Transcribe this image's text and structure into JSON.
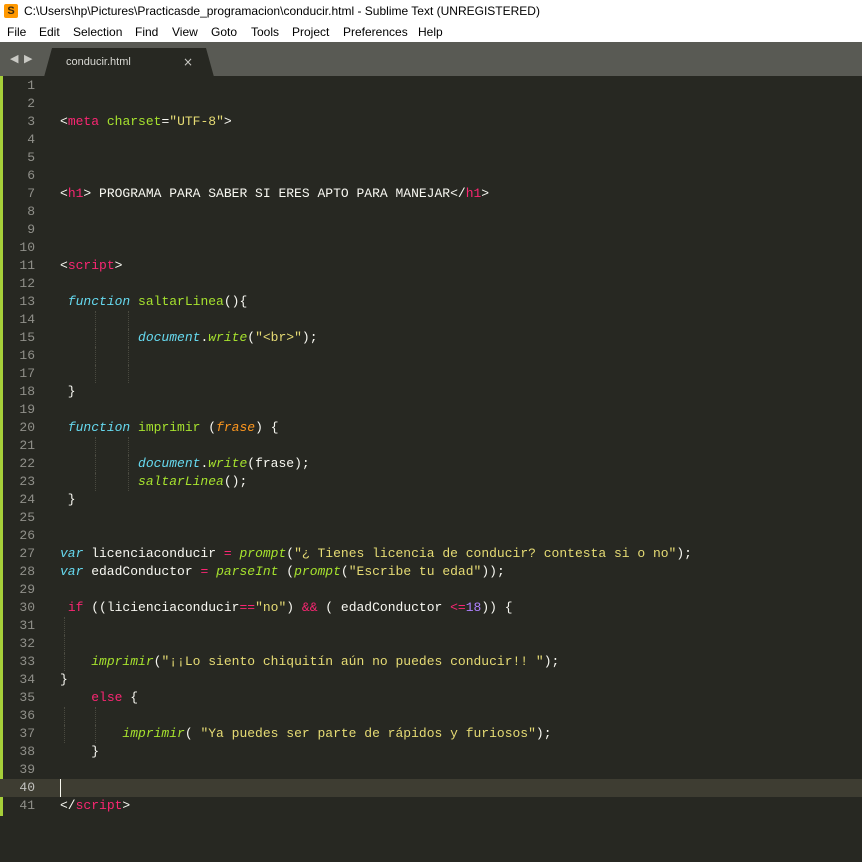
{
  "window": {
    "title": "C:\\Users\\hp\\Pictures\\Practicasde_programacion\\conducir.html - Sublime Text (UNREGISTERED)",
    "icon": "S"
  },
  "menu": {
    "items": [
      "File",
      "Edit",
      "Selection",
      "Find",
      "View",
      "Goto",
      "Tools",
      "Project",
      "Preferences",
      "Help"
    ]
  },
  "tabs": {
    "back": "◀",
    "forward": "▶",
    "active": {
      "label": "conducir.html",
      "close": "×"
    }
  },
  "colors": {
    "background": "#272822",
    "text": "#f8f8f2",
    "keyword": "#f92672",
    "tag": "#f92672",
    "storage": "#66d9ef",
    "function": "#a6e22e",
    "string": "#e6db74",
    "number": "#ae81ff",
    "parameter": "#fd971f",
    "gutter_marker": "#a6cf39"
  },
  "editor": {
    "current_line": 40,
    "lines": [
      {
        "n": "1",
        "t": []
      },
      {
        "n": "2",
        "t": []
      },
      {
        "n": "3",
        "t": [
          [
            "p",
            "<"
          ],
          [
            "t",
            "meta"
          ],
          [
            "p",
            " "
          ],
          [
            "a",
            "charset"
          ],
          [
            "p",
            "="
          ],
          [
            "s",
            "\"UTF-8\""
          ],
          [
            "p",
            ">"
          ]
        ]
      },
      {
        "n": "4",
        "t": []
      },
      {
        "n": "5",
        "t": []
      },
      {
        "n": "6",
        "t": []
      },
      {
        "n": "7",
        "t": [
          [
            "p",
            "<"
          ],
          [
            "t",
            "h1"
          ],
          [
            "p",
            "> PROGRAMA PARA SABER SI ERES APTO PARA MANEJAR</"
          ],
          [
            "t",
            "h1"
          ],
          [
            "p",
            ">"
          ]
        ]
      },
      {
        "n": "8",
        "t": []
      },
      {
        "n": "9",
        "t": []
      },
      {
        "n": "10",
        "t": []
      },
      {
        "n": "11",
        "t": [
          [
            "p",
            "<"
          ],
          [
            "t",
            "script"
          ],
          [
            "p",
            ">"
          ]
        ]
      },
      {
        "n": "12",
        "t": []
      },
      {
        "n": "13",
        "t": [
          [
            "p",
            " "
          ],
          [
            "c",
            "function"
          ],
          [
            "p",
            " "
          ],
          [
            "f",
            "saltarLinea"
          ],
          [
            "p",
            "(){"
          ]
        ]
      },
      {
        "n": "14",
        "t": []
      },
      {
        "n": "15",
        "t": [
          [
            "p",
            "          "
          ],
          [
            "c",
            "document"
          ],
          [
            "p",
            "."
          ],
          [
            "c",
            "write"
          ],
          [
            "p",
            "("
          ],
          [
            "s",
            "\"<br>\""
          ],
          [
            "p",
            ");"
          ]
        ]
      },
      {
        "n": "16",
        "t": []
      },
      {
        "n": "17",
        "t": []
      },
      {
        "n": "18",
        "t": [
          [
            "p",
            " }"
          ]
        ]
      },
      {
        "n": "19",
        "t": []
      },
      {
        "n": "20",
        "t": [
          [
            "p",
            " "
          ],
          [
            "c",
            "function"
          ],
          [
            "p",
            " "
          ],
          [
            "f",
            "imprimir"
          ],
          [
            "p",
            " ("
          ],
          [
            "v",
            "frase"
          ],
          [
            "p",
            ") {"
          ]
        ]
      },
      {
        "n": "21",
        "t": []
      },
      {
        "n": "22",
        "t": [
          [
            "p",
            "          "
          ],
          [
            "c",
            "document"
          ],
          [
            "p",
            "."
          ],
          [
            "c",
            "write"
          ],
          [
            "p",
            "(frase);"
          ]
        ]
      },
      {
        "n": "23",
        "t": [
          [
            "p",
            "          "
          ],
          [
            "c",
            "saltarLinea"
          ],
          [
            "p",
            "();"
          ]
        ]
      },
      {
        "n": "24",
        "t": [
          [
            "p",
            " }"
          ]
        ]
      },
      {
        "n": "25",
        "t": []
      },
      {
        "n": "26",
        "t": []
      },
      {
        "n": "27",
        "t": [
          [
            "c",
            "var"
          ],
          [
            "p",
            " licenciaconducir "
          ],
          [
            "k",
            "="
          ],
          [
            "p",
            " "
          ],
          [
            "c",
            "prompt"
          ],
          [
            "p",
            "("
          ],
          [
            "s",
            "\"¿ Tienes licencia de conducir? contesta si o no\""
          ],
          [
            "p",
            ");"
          ]
        ]
      },
      {
        "n": "28",
        "t": [
          [
            "c",
            "var"
          ],
          [
            "p",
            " edadConductor "
          ],
          [
            "k",
            "="
          ],
          [
            "p",
            " "
          ],
          [
            "c",
            "parseInt"
          ],
          [
            "p",
            " ("
          ],
          [
            "c",
            "prompt"
          ],
          [
            "p",
            "("
          ],
          [
            "s",
            "\"Escribe tu edad\""
          ],
          [
            "p",
            "));"
          ]
        ]
      },
      {
        "n": "29",
        "t": []
      },
      {
        "n": "30",
        "t": [
          [
            "p",
            " "
          ],
          [
            "k",
            "if"
          ],
          [
            "p",
            " ((licienciaconducir"
          ],
          [
            "k",
            "=="
          ],
          [
            "s",
            "\"no\""
          ],
          [
            "p",
            ") "
          ],
          [
            "k",
            "&&"
          ],
          [
            "p",
            " ( edadConductor "
          ],
          [
            "k",
            "<="
          ],
          [
            "n",
            "18"
          ],
          [
            "p",
            ")) {"
          ]
        ]
      },
      {
        "n": "31",
        "t": []
      },
      {
        "n": "32",
        "t": []
      },
      {
        "n": "33",
        "t": [
          [
            "p",
            "    "
          ],
          [
            "c",
            "imprimir"
          ],
          [
            "p",
            "("
          ],
          [
            "s",
            "\"¡¡Lo siento chiquitín aún no puedes conducir!! \""
          ],
          [
            "p",
            ");"
          ]
        ]
      },
      {
        "n": "34",
        "t": [
          [
            "p",
            "}"
          ]
        ]
      },
      {
        "n": "35",
        "t": [
          [
            "p",
            "    "
          ],
          [
            "k",
            "else"
          ],
          [
            "p",
            " {"
          ]
        ]
      },
      {
        "n": "36",
        "t": []
      },
      {
        "n": "37",
        "t": [
          [
            "p",
            "        "
          ],
          [
            "c",
            "imprimir"
          ],
          [
            "p",
            "( "
          ],
          [
            "s",
            "\"Ya puedes ser parte de rápidos y furiosos\""
          ],
          [
            "p",
            ");"
          ]
        ]
      },
      {
        "n": "38",
        "t": [
          [
            "p",
            "    }"
          ]
        ]
      },
      {
        "n": "39",
        "t": []
      },
      {
        "n": "40",
        "t": []
      },
      {
        "n": "41",
        "t": [
          [
            "p",
            "</"
          ],
          [
            "t",
            "script"
          ],
          [
            "p",
            ">"
          ]
        ]
      }
    ]
  }
}
